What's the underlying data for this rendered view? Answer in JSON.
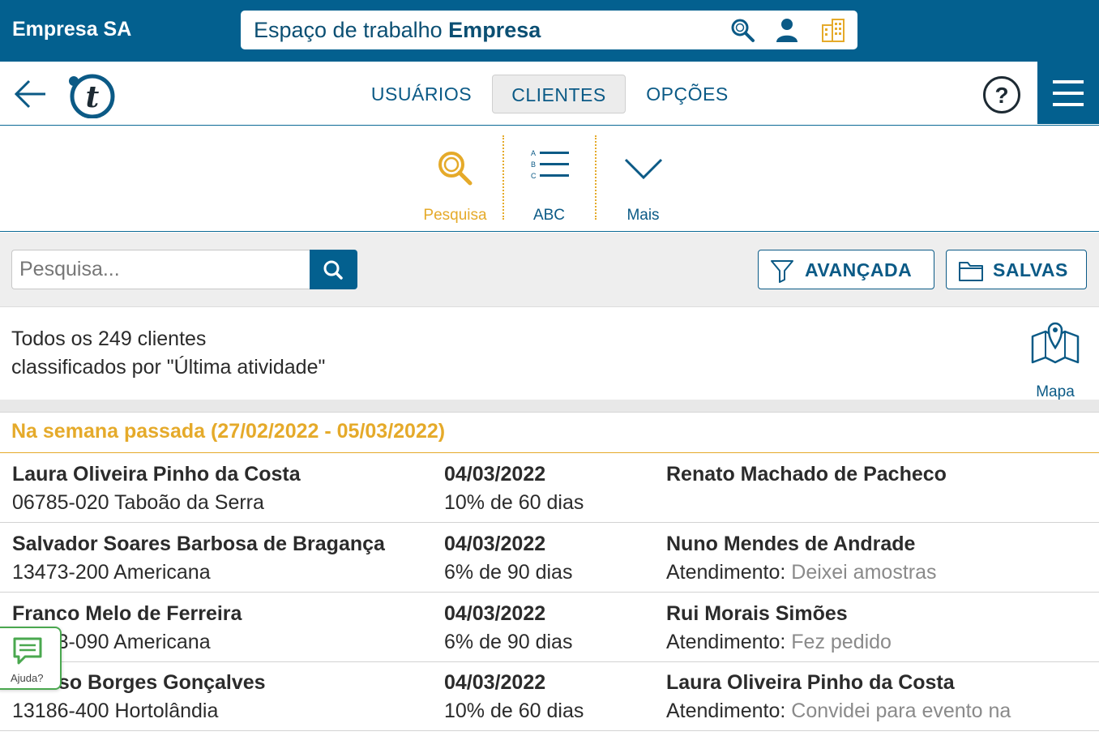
{
  "header": {
    "company": "Empresa SA",
    "workspace_prefix": "Espaço de trabalho ",
    "workspace_name": "Empresa"
  },
  "nav": {
    "tabs": [
      {
        "label": "USUÁRIOS",
        "active": false
      },
      {
        "label": "CLIENTES",
        "active": true
      },
      {
        "label": "OPÇÕES",
        "active": false
      }
    ]
  },
  "tools": [
    {
      "label": "Pesquisa",
      "icon": "search-icon",
      "active": true
    },
    {
      "label": "ABC",
      "icon": "abc-list-icon",
      "active": false
    },
    {
      "label": "Mais",
      "icon": "chevron-down-icon",
      "active": false
    }
  ],
  "search": {
    "placeholder": "Pesquisa...",
    "advanced_label": "AVANÇADA",
    "saved_label": "SALVAS"
  },
  "summary": {
    "line1": "Todos os 249 clientes",
    "line2": "classificados por \"Última atividade\"",
    "map_label": "Mapa"
  },
  "group_title": "Na semana passada (27/02/2022 - 05/03/2022)",
  "clients": [
    {
      "name": "Laura Oliveira Pinho da Costa",
      "address": "06785-020 Taboão da Serra",
      "date": "04/03/2022",
      "progress": "10% de 60 dias",
      "user": "Renato Machado de Pacheco",
      "activity_label": "",
      "activity": ""
    },
    {
      "name": "Salvador Soares Barbosa de Bragança",
      "address": "13473-200 Americana",
      "date": "04/03/2022",
      "progress": "6% de 90 dias",
      "user": "Nuno Mendes de Andrade",
      "activity_label": "Atendimento: ",
      "activity": "Deixei amostras"
    },
    {
      "name": "Franco Melo de Ferreira",
      "address": "13473-090 Americana",
      "date": "04/03/2022",
      "progress": "6% de 90 dias",
      "user": "Rui Morais Simões",
      "activity_label": "Atendimento: ",
      "activity": "Fez pedido"
    },
    {
      "name": "Afonso Borges Gonçalves",
      "address": "13186-400 Hortolândia",
      "date": "04/03/2022",
      "progress": "10% de 60 dias",
      "user": "Laura Oliveira Pinho da Costa",
      "activity_label": "Atendimento: ",
      "activity": "Convidei para evento na"
    }
  ],
  "help_widget": {
    "label": "Ajuda?"
  },
  "colors": {
    "brand": "#03608f",
    "accent": "#e5aa2a",
    "help": "#4aa84f"
  }
}
